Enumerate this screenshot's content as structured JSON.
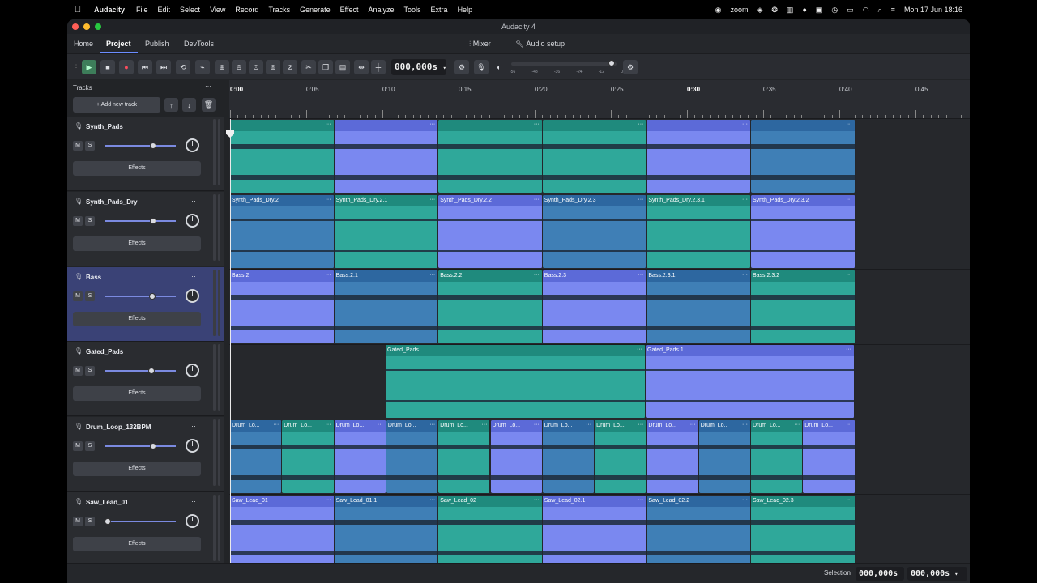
{
  "menubar": {
    "app": "Audacity",
    "items": [
      "File",
      "Edit",
      "Select",
      "View",
      "Record",
      "Tracks",
      "Generate",
      "Effect",
      "Analyze",
      "Tools",
      "Extra",
      "Help"
    ],
    "status_zoom": "zoom",
    "datetime": "Mon 17 Jun  18:16"
  },
  "window": {
    "title": "Audacity 4"
  },
  "nav": {
    "tabs": [
      "Home",
      "Project",
      "Publish",
      "DevTools"
    ],
    "active": "Project",
    "mixer": "Mixer",
    "audio_setup": "Audio setup"
  },
  "toolbar": {
    "timecode": "000,000s",
    "vu_ticks": [
      "-56",
      "-48",
      "-36",
      "-24",
      "-12",
      "0"
    ]
  },
  "tracks_panel": {
    "header": "Tracks",
    "add_track": "Add new track",
    "mute_label": "M",
    "solo_label": "S",
    "effects_label": "Effects",
    "tracks": [
      {
        "name": "Synth_Pads",
        "selected": false,
        "gain": 0.68
      },
      {
        "name": "Synth_Pads_Dry",
        "selected": false,
        "gain": 0.68
      },
      {
        "name": "Bass",
        "selected": true,
        "gain": 0.67
      },
      {
        "name": "Gated_Pads",
        "selected": false,
        "gain": 0.66
      },
      {
        "name": "Drum_Loop_132BPM",
        "selected": false,
        "gain": 0.68
      },
      {
        "name": "Saw_Lead_01",
        "selected": false,
        "gain": 0.05
      }
    ]
  },
  "ruler": {
    "labels": [
      "0:00",
      "0:05",
      "0:10",
      "0:15",
      "0:20",
      "0:25",
      "0:30",
      "0:35",
      "0:40",
      "0:45"
    ],
    "bold": [
      "0:00",
      "0:30"
    ]
  },
  "clips": {
    "synth_pads": [
      "",
      "",
      "",
      "",
      "",
      ""
    ],
    "synth_pads_dry": [
      "Synth_Pads_Dry.2",
      "Synth_Pads_Dry.2.1",
      "Synth_Pads_Dry.2.2",
      "Synth_Pads_Dry.2.3",
      "Synth_Pads_Dry.2.3.1",
      "Synth_Pads_Dry.2.3.2"
    ],
    "bass": [
      "Bass.2",
      "Bass.2.1",
      "Bass.2.2",
      "Bass.2.3",
      "Bass.2.3.1",
      "Bass.2.3.2"
    ],
    "gated_pads": [
      "Gated_Pads",
      "Gated_Pads.1"
    ],
    "drum_loop": [
      "Drum_Lo...",
      "Drum_Lo...",
      "Drum_Lo...",
      "Drum_Lo...",
      "Drum_Lo...",
      "Drum_Lo...",
      "Drum_Lo...",
      "Drum_Lo...",
      "Drum_Lo...",
      "Drum_Lo...",
      "Drum_Lo...",
      "Drum_Lo..."
    ],
    "saw_lead": [
      "Saw_Lead_01",
      "Saw_Lead_01.1",
      "Saw_Lead_02",
      "Saw_Lead_02.1",
      "Saw_Lead_02.2",
      "Saw_Lead_02.3"
    ],
    "more": "···"
  },
  "statusbar": {
    "selection_label": "Selection",
    "start": "000,000s",
    "end": "000,000s"
  },
  "colors": {
    "accent": "#6b8cff",
    "teal": "#2fa89a",
    "lavender": "#7a88f0",
    "blue": "#3f7fb6",
    "record": "#ff4d5e"
  }
}
